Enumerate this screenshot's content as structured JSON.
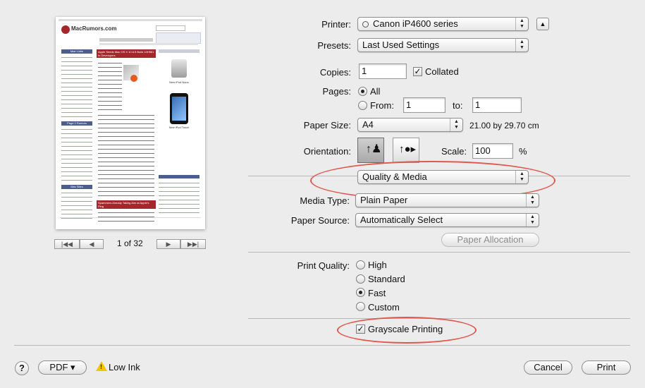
{
  "preview": {
    "site_name": "MacRumors.com",
    "headline1": "Apple Seeds Mac OS X 10.6.5 Build 10H561 to Developers",
    "headline2": "Spammers Already Taking Aim at Apple's Ping",
    "sidebar_heading1": "Mac Links",
    "sidebar_heading2": "Page 2 Rumors",
    "sidebar_heading3": "Mac Sites",
    "product1": "New iPod Nano",
    "product2": "New iPod Touch"
  },
  "pager": {
    "first": "|◀◀",
    "prev": "◀",
    "next": "▶",
    "last": "▶▶|",
    "status": "1 of 32"
  },
  "printer": {
    "label": "Printer:",
    "value": "Canon iP4600 series",
    "expand": "▲"
  },
  "presets": {
    "label": "Presets:",
    "value": "Last Used Settings"
  },
  "copies": {
    "label": "Copies:",
    "value": "1",
    "collated_label": "Collated",
    "collated_checked": "✓"
  },
  "pages": {
    "label": "Pages:",
    "all": "All",
    "from": "From:",
    "from_value": "1",
    "to": "to:",
    "to_value": "1"
  },
  "paper_size": {
    "label": "Paper Size:",
    "value": "A4",
    "dims": "21.00 by 29.70 cm"
  },
  "orientation": {
    "label": "Orientation:",
    "scale_label": "Scale:",
    "scale_value": "100",
    "percent": "%"
  },
  "section": {
    "value": "Quality & Media"
  },
  "media_type": {
    "label": "Media Type:",
    "value": "Plain Paper"
  },
  "paper_source": {
    "label": "Paper Source:",
    "value": "Automatically Select"
  },
  "paper_allocation": {
    "label": "Paper Allocation"
  },
  "print_quality": {
    "label": "Print Quality:",
    "options": [
      "High",
      "Standard",
      "Fast",
      "Custom"
    ]
  },
  "grayscale": {
    "label": "Grayscale Printing",
    "checked": "✓"
  },
  "footer": {
    "help": "?",
    "pdf": "PDF ▾",
    "low_ink": "Low Ink",
    "cancel": "Cancel",
    "print": "Print"
  },
  "colors": {
    "highlight_oval": "#e0584f",
    "site_red": "#a4272b"
  }
}
